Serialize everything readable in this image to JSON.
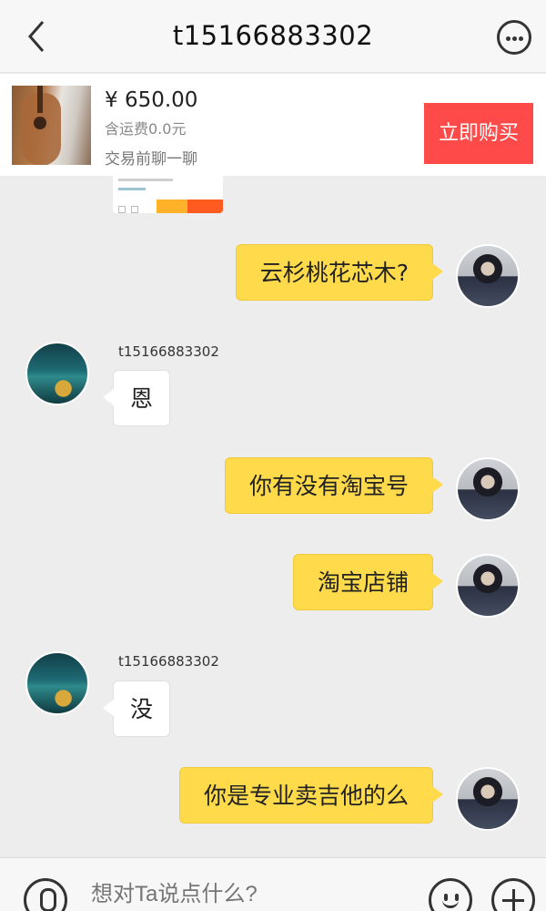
{
  "header": {
    "title": "t15166883302",
    "back_icon": "chevron-left-icon",
    "more_icon": "more-dots-icon"
  },
  "product": {
    "price": "¥ 650.00",
    "shipping": "含运费0.0元",
    "hint": "交易前聊一聊",
    "buy_label": "立即购买"
  },
  "messages": [
    {
      "direction": "out",
      "text": "云杉桃花芯木?"
    },
    {
      "direction": "in",
      "sender": "t15166883302",
      "text": "恩"
    },
    {
      "direction": "out",
      "text": "你有没有淘宝号"
    },
    {
      "direction": "out",
      "text": "淘宝店铺"
    },
    {
      "direction": "in",
      "sender": "t15166883302",
      "text": "没"
    },
    {
      "direction": "out",
      "text": "你是专业卖吉他的么"
    }
  ],
  "input": {
    "placeholder": "想对Ta说点什么?",
    "voice_icon": "microphone-icon",
    "emoji_icon": "smiley-icon",
    "plus_icon": "plus-icon"
  },
  "colors": {
    "outgoing_bubble": "#ffda4a",
    "incoming_bubble": "#ffffff",
    "buy_button": "#ff4a4a",
    "chat_background": "#ededed"
  }
}
